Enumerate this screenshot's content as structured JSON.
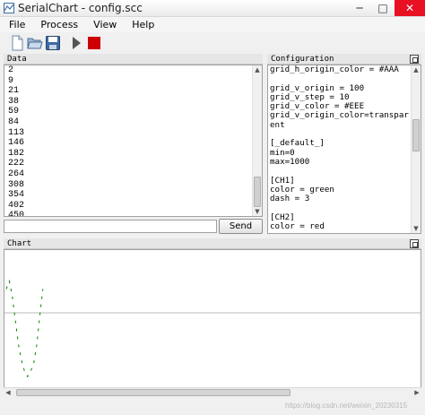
{
  "window": {
    "title": "SerialChart - config.scc",
    "controls": {
      "minimize": "─",
      "maximize": "□",
      "close": "✕"
    }
  },
  "menu": [
    {
      "label": "File"
    },
    {
      "label": "Process"
    },
    {
      "label": "View"
    },
    {
      "label": "Help"
    }
  ],
  "toolbar": {
    "new": "new-file-icon",
    "open": "open-folder-icon",
    "save": "save-disk-icon",
    "run": "run-play-icon",
    "stop": "stop-icon",
    "run_color": "#555555",
    "stop_color": "#cc0000"
  },
  "data_panel": {
    "title": "Data",
    "lines": [
      "2",
      "9",
      "21",
      "38",
      "59",
      "84",
      "113",
      "146",
      "182",
      "222",
      "264",
      "308",
      "354",
      "402",
      "450"
    ],
    "input_value": "",
    "send_label": "Send"
  },
  "config_panel": {
    "title": "Configuration",
    "text": "grid_h_origin_color = #AAA\n\ngrid_v_origin = 100\ngrid_v_step = 10\ngrid_v_color = #EEE\ngrid_v_origin_color=transparent\n\n[_default_]\nmin=0\nmax=1000\n\n[CH1]\ncolor = green\ndash = 3\n\n[CH2]\ncolor = red"
  },
  "chart_panel": {
    "title": "Chart"
  },
  "chart_data": {
    "type": "line",
    "series": [
      {
        "color": "green",
        "dash": 3,
        "values": [
          720,
          780,
          660,
          480,
          300,
          180,
          100,
          60,
          100,
          160,
          300,
          520,
          720
        ]
      }
    ],
    "ylim": [
      0,
      1000
    ]
  },
  "watermark": "https://blog.csdn.net/weixin_20230315"
}
